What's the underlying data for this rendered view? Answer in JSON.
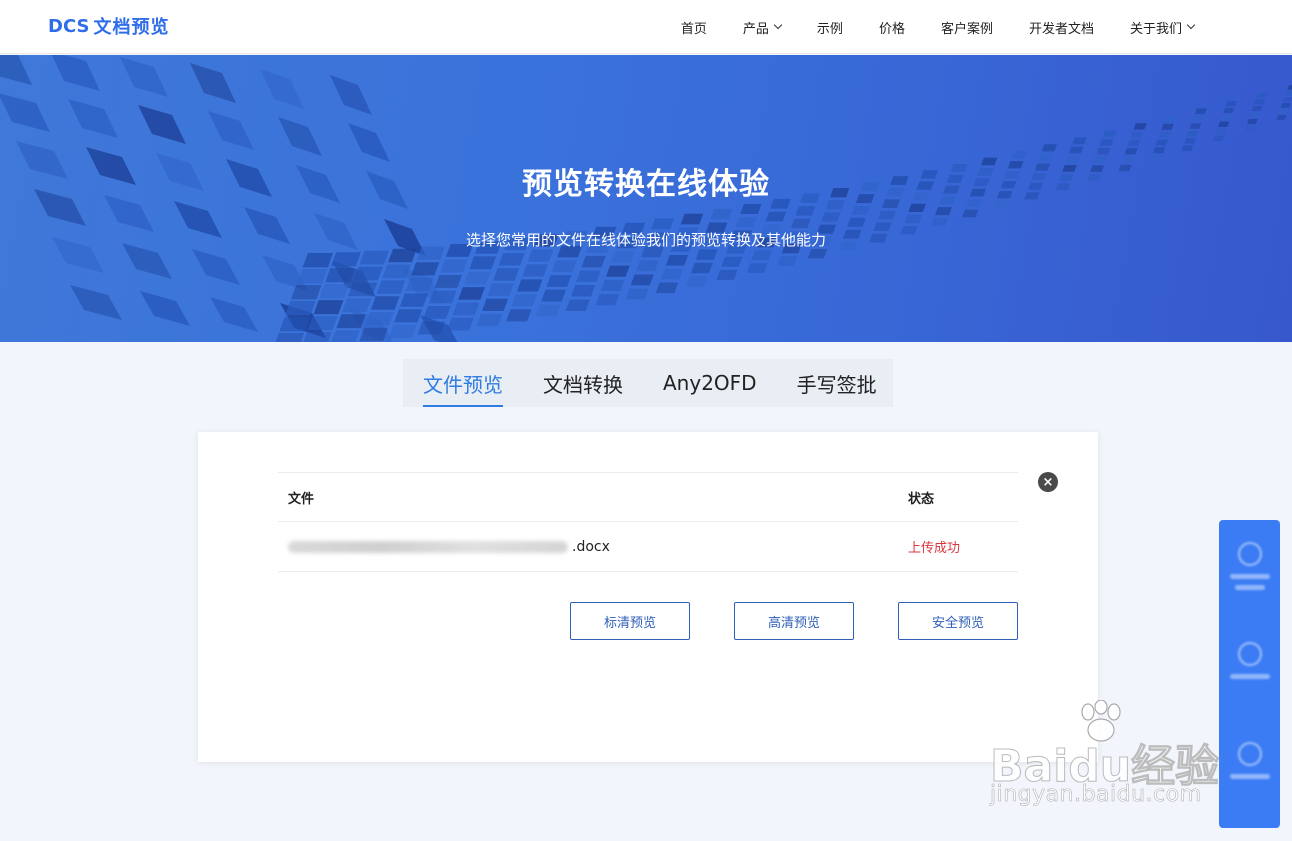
{
  "header": {
    "logo_mark": "DCS",
    "logo_text": "文档预览",
    "nav": [
      {
        "label": "首页",
        "has_dropdown": false
      },
      {
        "label": "产品",
        "has_dropdown": true
      },
      {
        "label": "示例",
        "has_dropdown": false
      },
      {
        "label": "价格",
        "has_dropdown": false
      },
      {
        "label": "客户案例",
        "has_dropdown": false
      },
      {
        "label": "开发者文档",
        "has_dropdown": false
      },
      {
        "label": "关于我们",
        "has_dropdown": true
      }
    ]
  },
  "hero": {
    "title": "预览转换在线体验",
    "subtitle": "选择您常用的文件在线体验我们的预览转换及其他能力"
  },
  "tabs": [
    {
      "label": "文件预览",
      "active": true
    },
    {
      "label": "文档转换",
      "active": false
    },
    {
      "label": "Any2OFD",
      "active": false
    },
    {
      "label": "手写签批",
      "active": false
    }
  ],
  "upload": {
    "columns": {
      "file": "文件",
      "status": "状态"
    },
    "rows": [
      {
        "file_ext": ".docx",
        "status": "上传成功"
      }
    ],
    "close_icon": "×",
    "buttons": {
      "standard": "标清预览",
      "hd": "高清预览",
      "secure": "安全预览"
    }
  },
  "watermark": {
    "main": "Baidu经验",
    "sub": "jingyan.baidu.com"
  },
  "colors": {
    "brand": "#2f6ee9",
    "hero": "#3a72db",
    "tab_active": "#2f7be0",
    "status_success": "#d9363e",
    "side_panel": "#3b7cf5"
  }
}
